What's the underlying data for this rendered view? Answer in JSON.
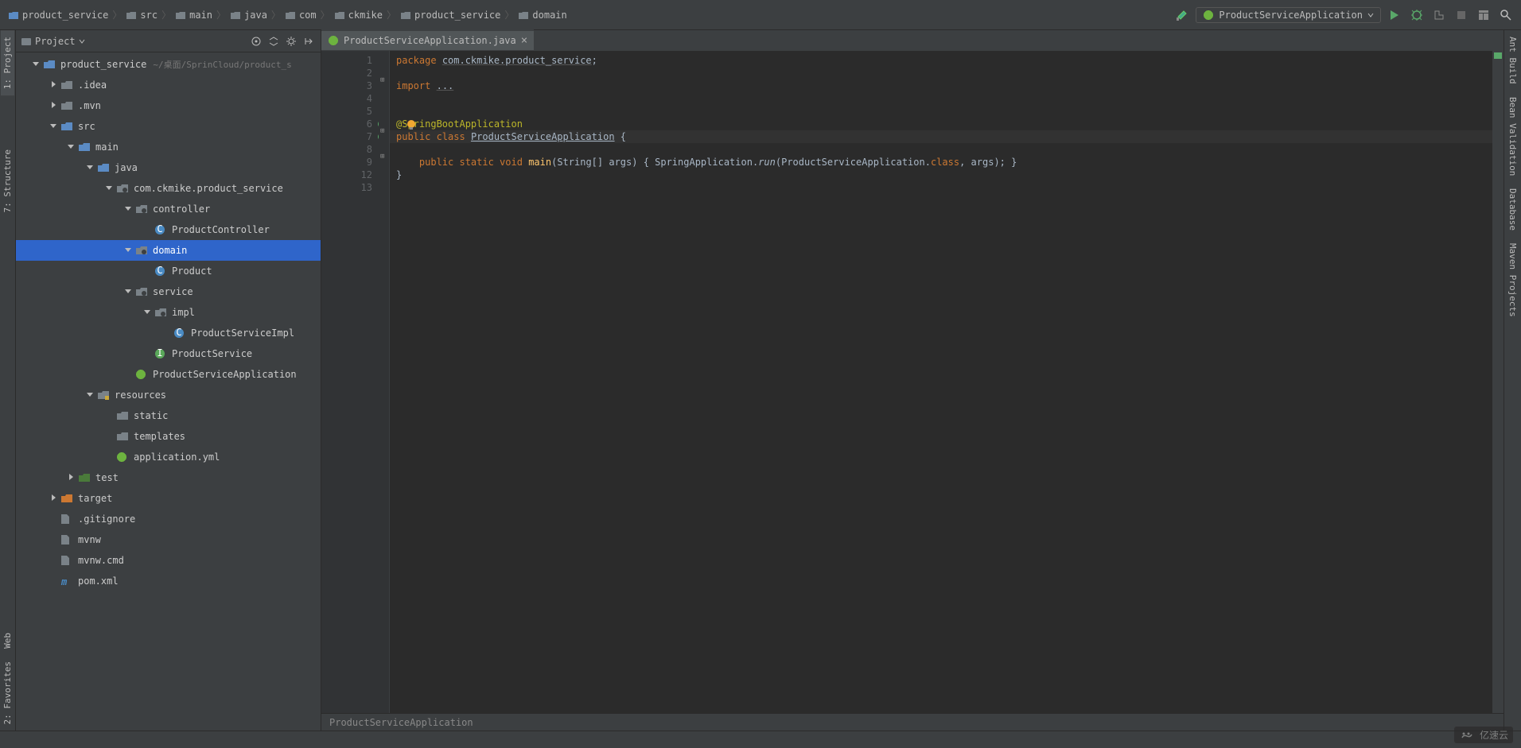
{
  "breadcrumbs": [
    "product_service",
    "src",
    "main",
    "java",
    "com",
    "ckmike",
    "product_service",
    "domain"
  ],
  "run_config": "ProductServiceApplication",
  "panel_title": "Project",
  "tab": {
    "label": "ProductServiceApplication.java"
  },
  "left_tabs": [
    "1: Project",
    "7: Structure",
    "Web",
    "2: Favorites"
  ],
  "right_tabs": [
    "Ant Build",
    "Bean Validation",
    "Database",
    "Maven Projects"
  ],
  "tree": [
    {
      "d": 0,
      "arrow": "down",
      "icon": "folder-mod",
      "label": "product_service",
      "path": "~/桌面/SprinCloud/product_s"
    },
    {
      "d": 1,
      "arrow": "right",
      "icon": "folder",
      "label": ".idea"
    },
    {
      "d": 1,
      "arrow": "right",
      "icon": "folder",
      "label": ".mvn"
    },
    {
      "d": 1,
      "arrow": "down",
      "icon": "folder-src",
      "label": "src"
    },
    {
      "d": 2,
      "arrow": "down",
      "icon": "folder-src",
      "label": "main"
    },
    {
      "d": 3,
      "arrow": "down",
      "icon": "folder-src",
      "label": "java"
    },
    {
      "d": 4,
      "arrow": "down",
      "icon": "package",
      "label": "com.ckmike.product_service"
    },
    {
      "d": 5,
      "arrow": "down",
      "icon": "package",
      "label": "controller"
    },
    {
      "d": 6,
      "arrow": "",
      "icon": "class",
      "label": "ProductController"
    },
    {
      "d": 5,
      "arrow": "down",
      "icon": "package",
      "label": "domain",
      "selected": true
    },
    {
      "d": 6,
      "arrow": "",
      "icon": "class",
      "label": "Product"
    },
    {
      "d": 5,
      "arrow": "down",
      "icon": "package",
      "label": "service"
    },
    {
      "d": 6,
      "arrow": "down",
      "icon": "package",
      "label": "impl"
    },
    {
      "d": 7,
      "arrow": "",
      "icon": "class",
      "label": "ProductServiceImpl"
    },
    {
      "d": 6,
      "arrow": "",
      "icon": "interface",
      "label": "ProductService"
    },
    {
      "d": 5,
      "arrow": "",
      "icon": "spring",
      "label": "ProductServiceApplication"
    },
    {
      "d": 3,
      "arrow": "down",
      "icon": "folder-res",
      "label": "resources"
    },
    {
      "d": 4,
      "arrow": "",
      "icon": "folder",
      "label": "static"
    },
    {
      "d": 4,
      "arrow": "",
      "icon": "folder",
      "label": "templates"
    },
    {
      "d": 4,
      "arrow": "",
      "icon": "spring-yml",
      "label": "application.yml"
    },
    {
      "d": 2,
      "arrow": "right",
      "icon": "folder-test",
      "label": "test"
    },
    {
      "d": 1,
      "arrow": "right",
      "icon": "folder-target",
      "label": "target"
    },
    {
      "d": 1,
      "arrow": "",
      "icon": "file",
      "label": ".gitignore"
    },
    {
      "d": 1,
      "arrow": "",
      "icon": "file",
      "label": "mvnw"
    },
    {
      "d": 1,
      "arrow": "",
      "icon": "file",
      "label": "mvnw.cmd"
    },
    {
      "d": 1,
      "arrow": "",
      "icon": "maven",
      "label": "pom.xml"
    }
  ],
  "gutter_lines": [
    "1",
    "2",
    "3",
    "4",
    "5",
    "6",
    "7",
    "8",
    "9",
    "12",
    "13"
  ],
  "code_lines": [
    {
      "n": 1,
      "html": "<span class='k-key'>package</span> <span class='k-pkg'>com.ckmike.product_service</span>;"
    },
    {
      "n": 2,
      "html": ""
    },
    {
      "n": 3,
      "html": "<span class='k-key'>import</span> <span class='k-pkg'>...</span>"
    },
    {
      "n": 4,
      "html": ""
    },
    {
      "n": 5,
      "html": ""
    },
    {
      "n": 6,
      "html": "<span class='k-ann'>@SpringBootApplication</span>",
      "bulb": true
    },
    {
      "n": 7,
      "html": "<span class='k-key'>public class</span> <span class='k-cls'>ProductServiceApplication</span> {",
      "caret": true
    },
    {
      "n": 8,
      "html": ""
    },
    {
      "n": 9,
      "html": "    <span class='k-key'>public static void</span> <span class='k-mth'>main</span>(String[] args) { SpringApplication.<span class='k-itl'>run</span>(<span style='color:#a9b7c6'>ProductServiceApplication</span>.<span class='k-key'>class</span>, args); }"
    },
    {
      "n": 12,
      "html": "}"
    },
    {
      "n": 13,
      "html": ""
    }
  ],
  "breadcrumb_bottom": "ProductServiceApplication",
  "watermark": "亿速云"
}
